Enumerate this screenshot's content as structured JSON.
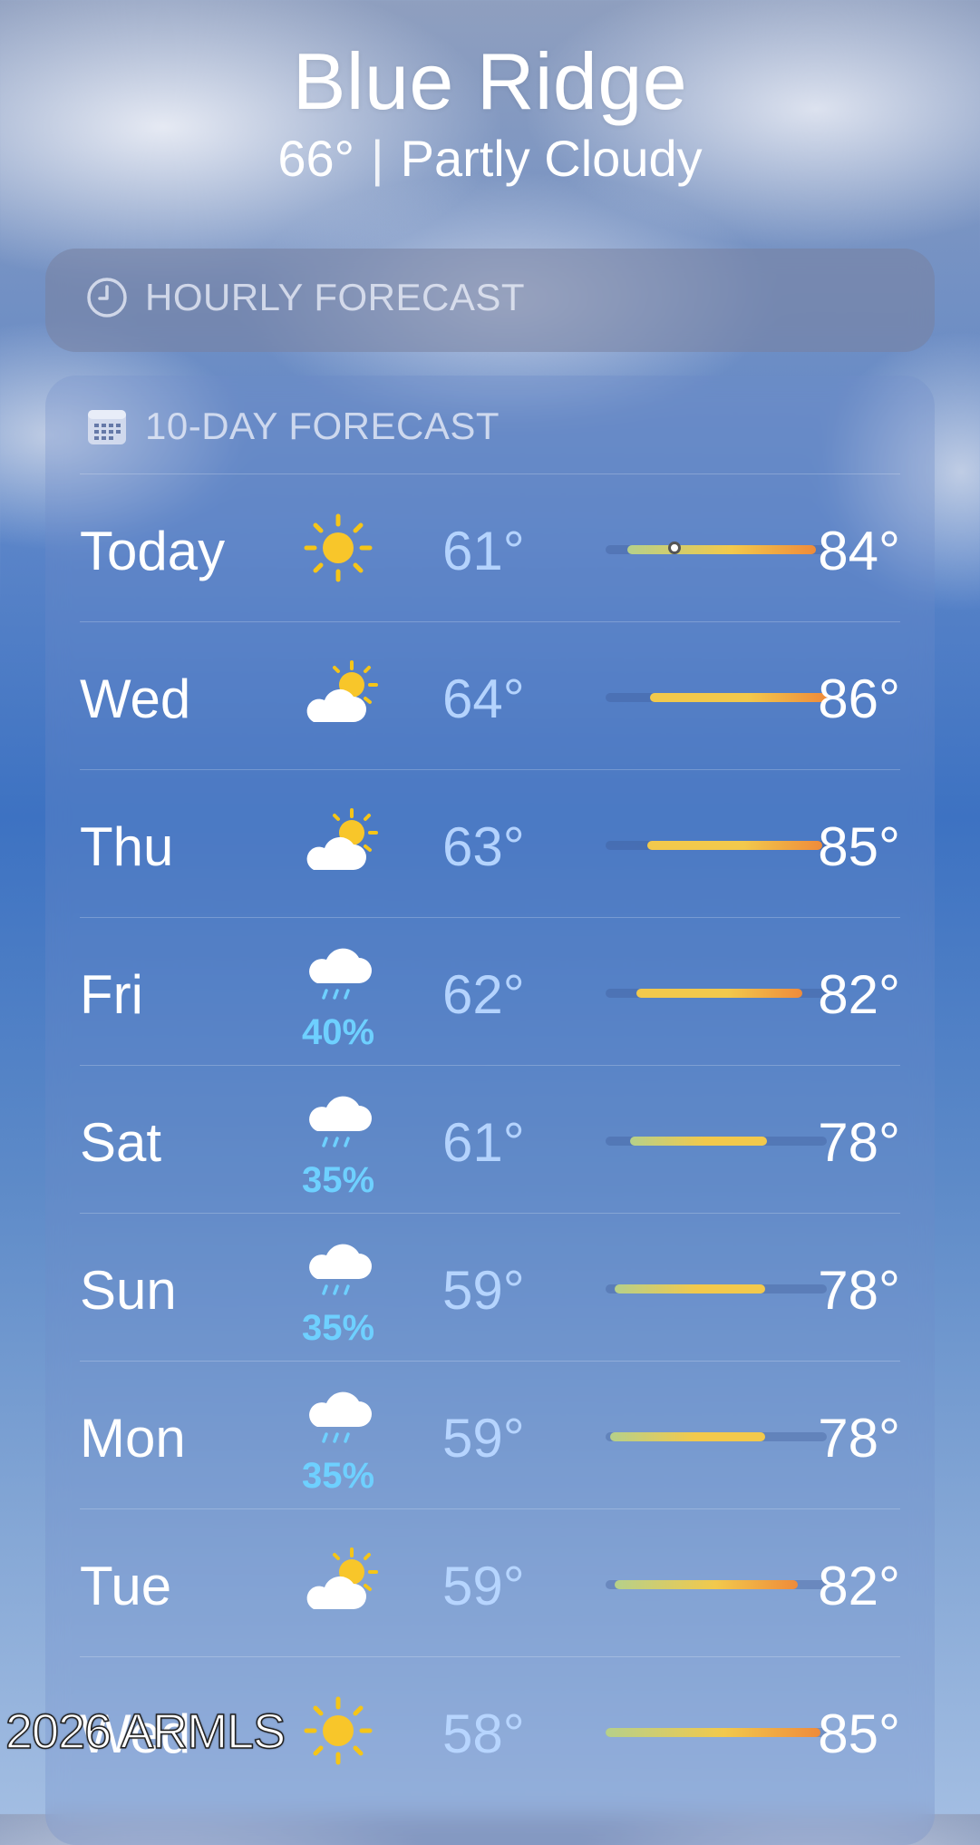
{
  "header": {
    "city": "Blue Ridge",
    "temp": "66°",
    "condition": "Partly Cloudy"
  },
  "hourly": {
    "title": "HOURLY FORECAST",
    "icon": "clock-icon"
  },
  "forecast": {
    "title": "10-DAY FORECAST",
    "icon": "calendar-icon",
    "days": [
      {
        "day": "Today",
        "icon": "sun-icon",
        "precip": "",
        "low": "61°",
        "high": "84°",
        "range_start": 0.1,
        "range_end": 0.95,
        "current": 0.31
      },
      {
        "day": "Wed",
        "icon": "partly-cloudy-icon",
        "precip": "",
        "low": "64°",
        "high": "86°",
        "range_start": 0.2,
        "range_end": 1.0
      },
      {
        "day": "Thu",
        "icon": "partly-cloudy-icon",
        "precip": "",
        "low": "63°",
        "high": "85°",
        "range_start": 0.19,
        "range_end": 0.98
      },
      {
        "day": "Fri",
        "icon": "rain-cloud-icon",
        "precip": "40%",
        "low": "62°",
        "high": "82°",
        "range_start": 0.14,
        "range_end": 0.89
      },
      {
        "day": "Sat",
        "icon": "rain-cloud-icon",
        "precip": "35%",
        "low": "61°",
        "high": "78°",
        "range_start": 0.11,
        "range_end": 0.73
      },
      {
        "day": "Sun",
        "icon": "rain-cloud-icon",
        "precip": "35%",
        "low": "59°",
        "high": "78°",
        "range_start": 0.04,
        "range_end": 0.72
      },
      {
        "day": "Mon",
        "icon": "rain-cloud-icon",
        "precip": "35%",
        "low": "59°",
        "high": "78°",
        "range_start": 0.02,
        "range_end": 0.72
      },
      {
        "day": "Tue",
        "icon": "partly-cloudy-icon",
        "precip": "",
        "low": "59°",
        "high": "82°",
        "range_start": 0.04,
        "range_end": 0.87
      },
      {
        "day": "Wed",
        "icon": "sun-icon",
        "precip": "",
        "low": "58°",
        "high": "85°",
        "range_start": 0.0,
        "range_end": 0.97
      }
    ]
  },
  "watermark": "2026 ARMLS",
  "colors": {
    "precip": "#6ed0ff",
    "bar_cool": "#b6d08a",
    "bar_warm": "#f2c94c",
    "bar_hot": "#ef8b3a"
  }
}
